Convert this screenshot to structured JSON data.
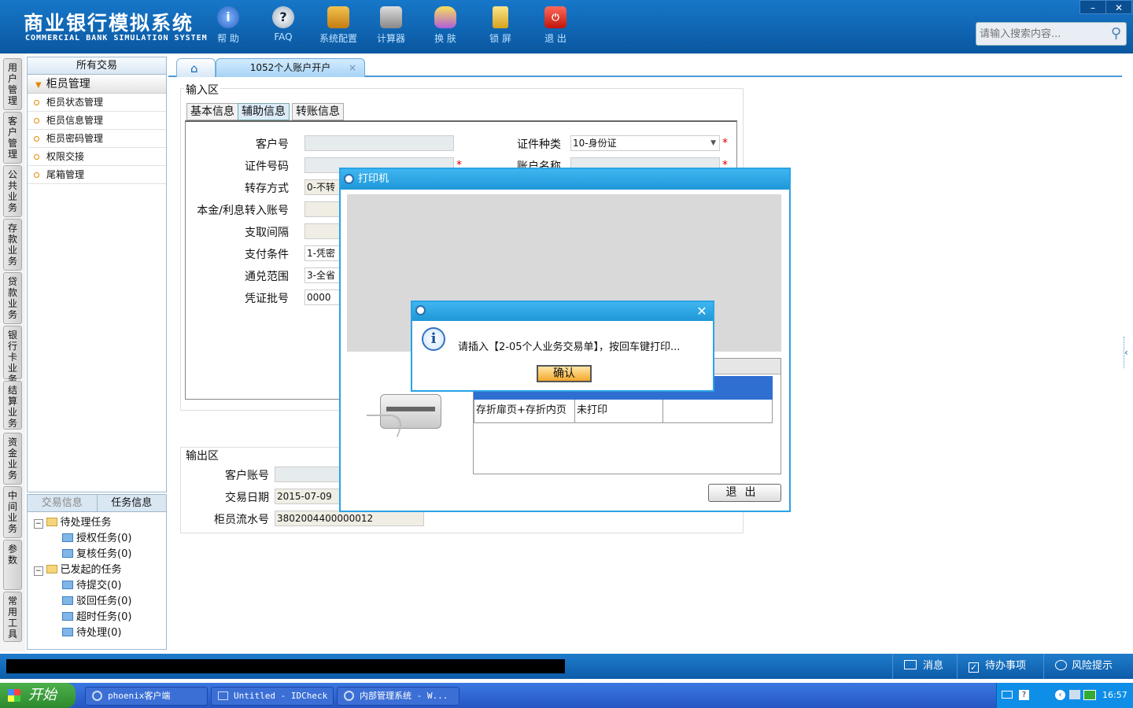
{
  "app": {
    "title": "商业银行模拟系统",
    "subtitle": "COMMERCIAL BANK SIMULATION SYSTEM"
  },
  "toolbar": [
    {
      "label": "帮 助",
      "icon": "help-icon"
    },
    {
      "label": "FAQ",
      "icon": "faq-icon"
    },
    {
      "label": "系统配置",
      "icon": "toolbox-icon"
    },
    {
      "label": "计算器",
      "icon": "calculator-icon"
    },
    {
      "label": "换 肤",
      "icon": "skin-icon"
    },
    {
      "label": "锁 屏",
      "icon": "lock-icon"
    },
    {
      "label": "退 出",
      "icon": "power-icon"
    }
  ],
  "window_controls": {
    "minimize": "–",
    "close": "✕"
  },
  "search": {
    "placeholder": "请输入搜索内容..."
  },
  "vnav": [
    "用户管理",
    "客户管理",
    "公共业务",
    "存款业务",
    "贷款业务",
    "银行卡业务",
    "结算业务",
    "资金业务",
    "中间业务",
    "参数",
    "常用工具"
  ],
  "tree": {
    "header": "所有交易",
    "group": "柜员管理",
    "items": [
      "柜员状态管理",
      "柜员信息管理",
      "柜员密码管理",
      "权限交接",
      "尾箱管理"
    ]
  },
  "task_panel": {
    "tabs": [
      "交易信息",
      "任务信息"
    ],
    "pending": "待处理任务",
    "pending_items": [
      "授权任务(0)",
      "复核任务(0)"
    ],
    "started": "已发起的任务",
    "started_items": [
      "待提交(0)",
      "驳回任务(0)",
      "超时任务(0)",
      "待处理(0)"
    ]
  },
  "tabs": {
    "active": "1052个人账户开户",
    "close": "×"
  },
  "input_area": {
    "label": "输入区",
    "subtabs": [
      "基本信息",
      "辅助信息",
      "转账信息"
    ],
    "fields": {
      "customer_no": "客户号",
      "id_no": "证件号码",
      "transfer_mode": "转存方式",
      "transfer_mode_value": "0-不转",
      "principal_account": "本金/利息转入账号",
      "withdraw_interval": "支取间隔",
      "pay_condition": "支付条件",
      "pay_condition_value": "1-凭密",
      "exchange_range": "通兑范围",
      "exchange_range_value": "3-全省",
      "voucher_batch": "凭证批号",
      "voucher_batch_value": "0000",
      "id_type": "证件种类",
      "id_type_value": "10-身份证",
      "account_name": "账户名称"
    },
    "required_mark": "*"
  },
  "output_area": {
    "label": "输出区",
    "customer_account": "客户账号",
    "trade_date": "交易日期",
    "trade_date_value": "2015-07-09",
    "teller_serial": "柜员流水号",
    "teller_serial_value": "3802004400000012"
  },
  "printer_dialog": {
    "title": "打印机",
    "row_item": "存折扉页+存折内页",
    "row_status": "未打印",
    "exit": "退出"
  },
  "confirm_dialog": {
    "message": "请插入【2-05个人业务交易单】，按回车键打印...",
    "ok": "确认",
    "close": "✕"
  },
  "statusbar": [
    {
      "label": "消息",
      "icon": "mail-icon"
    },
    {
      "label": "待办事项",
      "icon": "checkbox-icon"
    },
    {
      "label": "风险提示",
      "icon": "chat-icon"
    }
  ],
  "taskbar": {
    "start": "开始",
    "tasks": [
      "phoenix客户端",
      "Untitled - IDCheck",
      "内部管理系统 - W..."
    ],
    "time": "16:57"
  },
  "colors": {
    "header": "#0c5fa8",
    "accent": "#29a3e6",
    "required": "#dd0000"
  }
}
